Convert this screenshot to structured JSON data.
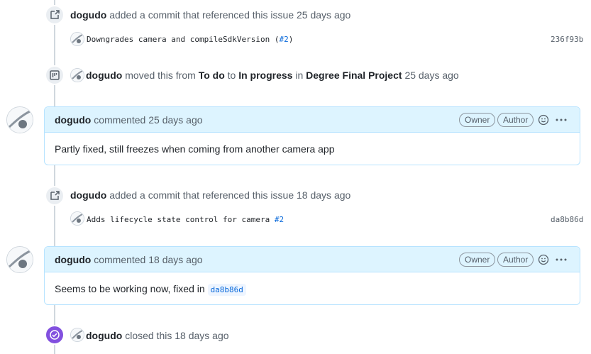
{
  "timeline": {
    "event1": {
      "user": "dogudo",
      "action": "added a commit that referenced this issue",
      "time": "25 days ago",
      "commit": {
        "message": "Downgrades camera and compileSdkVersion (",
        "ref": "#2",
        "suffix": ")",
        "sha": "236f93b"
      }
    },
    "event2": {
      "user": "dogudo",
      "moved": "moved this from",
      "from": "To do",
      "to_word": "to",
      "to": "In progress",
      "in_word": "in",
      "project": "Degree Final Project",
      "time": "25 days ago"
    },
    "comment1": {
      "user": "dogudo",
      "action": "commented",
      "time": "25 days ago",
      "owner_label": "Owner",
      "author_label": "Author",
      "body": "Partly fixed, still freezes when coming from another camera app"
    },
    "event3": {
      "user": "dogudo",
      "action": "added a commit that referenced this issue",
      "time": "18 days ago",
      "commit": {
        "message": "Adds lifecycle state control for camera",
        "ref": "#2",
        "sha": "da8b86d"
      }
    },
    "comment2": {
      "user": "dogudo",
      "action": "commented",
      "time": "18 days ago",
      "owner_label": "Owner",
      "author_label": "Author",
      "body": "Seems to be working now, fixed in",
      "sha_ref": "da8b86d"
    },
    "event4": {
      "user": "dogudo",
      "action": "closed this",
      "time": "18 days ago"
    }
  },
  "colors": {
    "accent": "#0969da",
    "comment_header": "#ddf4ff",
    "comment_border": "#b6e3ff",
    "closed_badge": "#8250df"
  },
  "icons": {
    "commit_ref": "cross-reference-icon",
    "project": "project-icon",
    "closed": "check-circle-icon",
    "emoji": "smiley-icon",
    "more": "kebab-horizontal-icon"
  }
}
